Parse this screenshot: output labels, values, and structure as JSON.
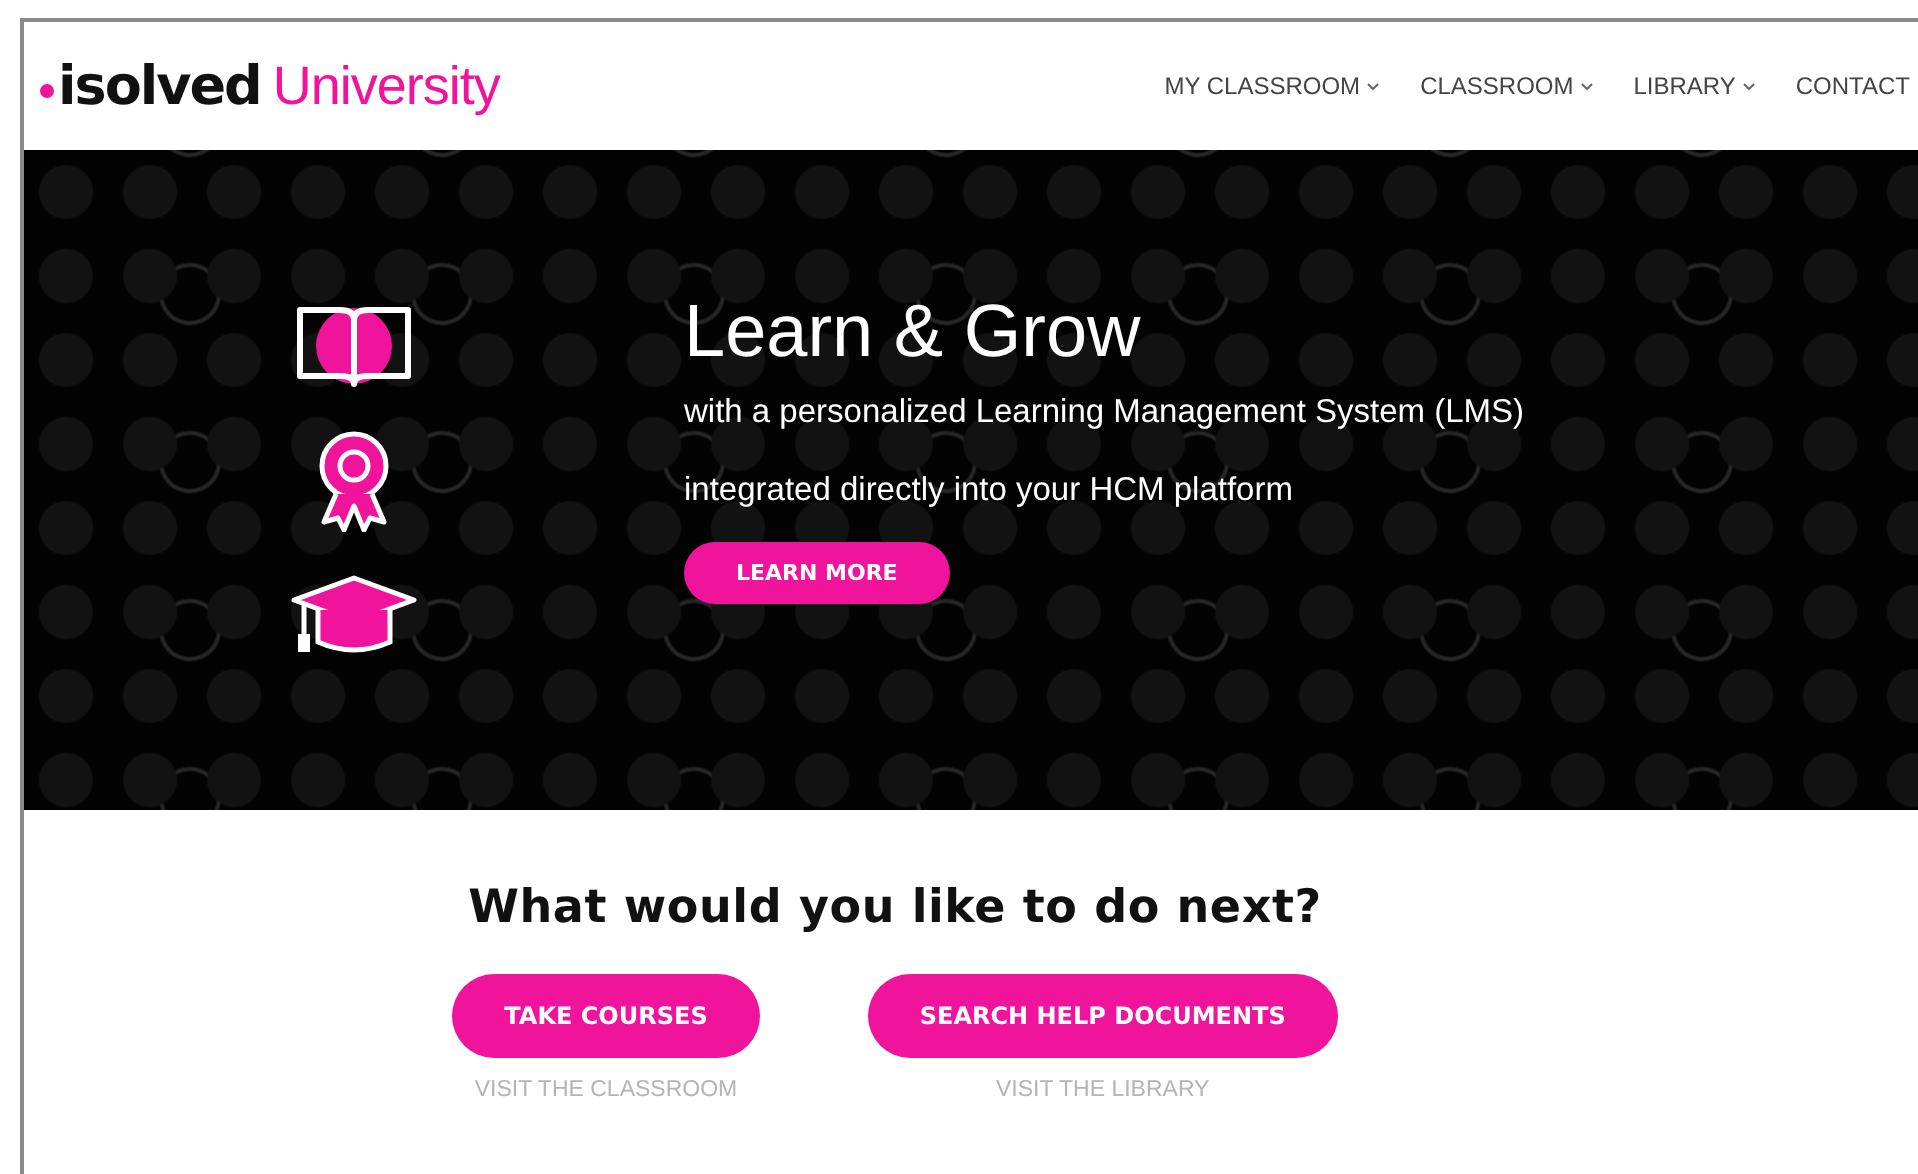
{
  "header": {
    "logo": {
      "brand": "isolved",
      "product": "University"
    },
    "nav": [
      {
        "label": "MY CLASSROOM",
        "has_menu": true
      },
      {
        "label": "CLASSROOM",
        "has_menu": true
      },
      {
        "label": "LIBRARY",
        "has_menu": true
      },
      {
        "label": "CONTACT",
        "has_menu": false
      }
    ]
  },
  "hero": {
    "title": "Learn & Grow",
    "lines": [
      "with a personalized Learning Management System (LMS)",
      "integrated directly into your HCM platform"
    ],
    "button": "LEARN MORE"
  },
  "next": {
    "heading": "What would you like to do next?",
    "actions": [
      {
        "button": "TAKE COURSES",
        "caption": "VISIT THE CLASSROOM"
      },
      {
        "button": "SEARCH HELP DOCUMENTS",
        "caption": "VISIT THE LIBRARY"
      }
    ]
  }
}
